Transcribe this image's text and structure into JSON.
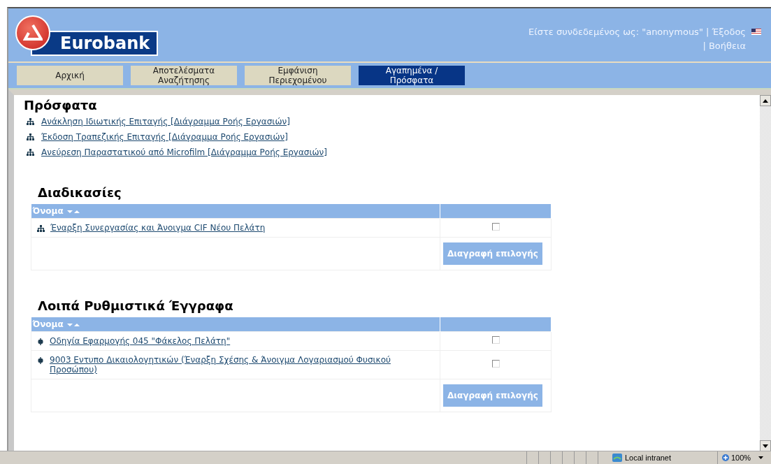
{
  "header": {
    "logo": "Eurobank",
    "user_info": "Είστε συνδεδεμένος ως: \"anonymous\"",
    "links": [
      {
        "separator": "|",
        "label": "Έξοδος"
      },
      {
        "separator": "|",
        "label": "Βοήθεια"
      }
    ]
  },
  "tabs": [
    {
      "label": "Αρχική",
      "selected": false
    },
    {
      "label": "Αποτελέσματα Αναζήτησης",
      "selected": false
    },
    {
      "label": "Εμφάνιση Περιεχομένου",
      "selected": false
    },
    {
      "label": "Αγαπημένα / Πρόσφατα",
      "selected": true
    }
  ],
  "recent": {
    "title": "Πρόσφατα",
    "items": [
      "Ανάκληση Ιδιωτικής Επιταγής [Διάγραμμα Ροής Εργασιών]",
      "Έκδοση Τραπεζικής Επιταγής [Διάγραμμα Ροής Εργασιών]",
      "Ανεύρεση Παραστατικού από Microfilm [Διάγραμμα Ροής Εργασιών]"
    ]
  },
  "sections": [
    {
      "title": "Διαδικασίες",
      "column": "Όνομα",
      "kind": "workflow",
      "button": "Διαγραφή επιλογής",
      "rows": [
        {
          "name": "Έναρξη Συνεργασίας και Άνοιγμα CIF Νέου Πελάτη",
          "checked": false
        }
      ]
    },
    {
      "title": "Λοιπά Ρυθμιστικά Έγγραφα",
      "column": "Όνομα",
      "kind": "document",
      "button": "Διαγραφή επιλογής",
      "rows": [
        {
          "name": "Οδηγία Εφαρμογής 045 \"Φάκελος Πελάτη\"",
          "checked": false
        },
        {
          "name": "9003 Εντυπο Δικαιολογητικών (Έναρξη Σχέσης & Άνοιγμα Λογαριασμού Φυσικού Προσώπου)",
          "checked": false
        }
      ]
    }
  ],
  "status_bar": {
    "zone": "Local intranet",
    "zoom": "100%"
  }
}
